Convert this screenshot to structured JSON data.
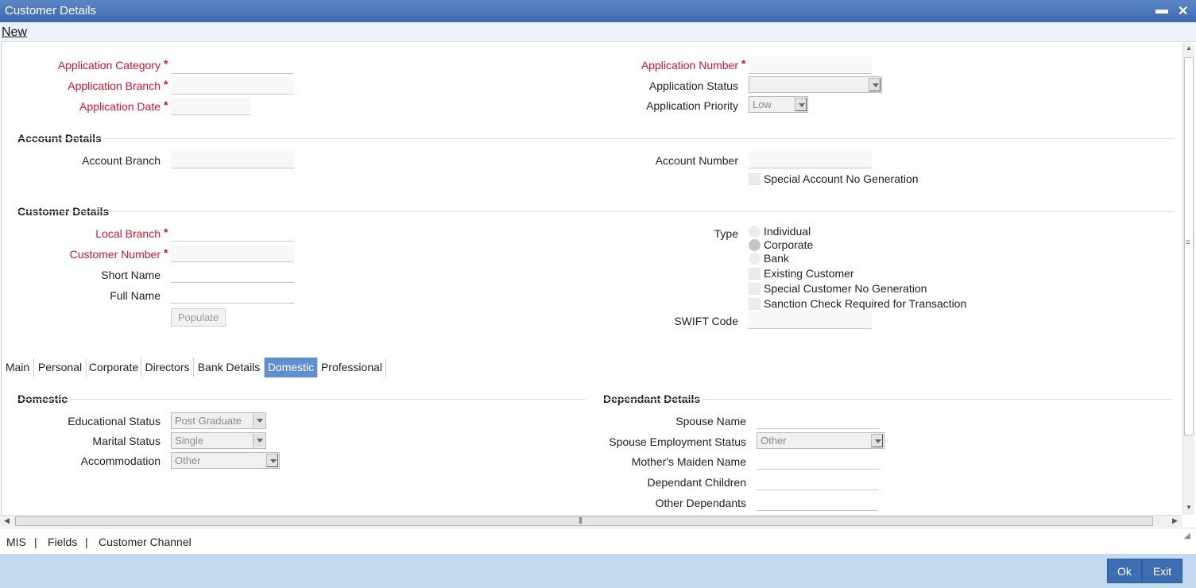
{
  "window": {
    "title": "Customer Details",
    "minimize_icon": "minimize-icon",
    "close_icon": "close-icon"
  },
  "menu": {
    "new_label": "New"
  },
  "header": {
    "app_category_label": "Application Category",
    "app_branch_label": "Application Branch",
    "app_date_label": "Application Date",
    "app_number_label": "Application Number",
    "app_status_label": "Application Status",
    "app_status_value": "",
    "app_priority_label": "Application Priority",
    "app_priority_value": "Low",
    "required_mark": "*"
  },
  "account": {
    "section_title": "Account Details",
    "branch_label": "Account Branch",
    "number_label": "Account Number",
    "special_no_label": "Special Account No Generation"
  },
  "customer": {
    "section_title": "Customer Details",
    "local_branch_label": "Local Branch",
    "customer_number_label": "Customer Number",
    "short_name_label": "Short Name",
    "full_name_label": "Full Name",
    "populate_label": "Populate",
    "type_label": "Type",
    "type_options": [
      "Individual",
      "Corporate",
      "Bank"
    ],
    "type_selected": "Corporate",
    "existing_customer_label": "Existing Customer",
    "special_customer_no_label": "Special Customer No Generation",
    "sanction_check_label": "Sanction Check Required for Transaction",
    "swift_code_label": "SWIFT Code"
  },
  "tabs": [
    "Main",
    "Personal",
    "Corporate",
    "Directors",
    "Bank Details",
    "Domestic",
    "Professional"
  ],
  "active_tab": "Domestic",
  "domestic": {
    "section_title": "Domestic",
    "educational_status_label": "Educational Status",
    "educational_status_value": "Post Graduate",
    "marital_status_label": "Marital Status",
    "marital_status_value": "Single",
    "accommodation_label": "Accommodation",
    "accommodation_value": "Other"
  },
  "dependant": {
    "section_title": "Dependant Details",
    "spouse_name_label": "Spouse Name",
    "spouse_employment_label": "Spouse Employment Status",
    "spouse_employment_value": "Other",
    "mothers_maiden_label": "Mother's Maiden Name",
    "dependant_children_label": "Dependant Children",
    "other_dependants_label": "Other Dependants"
  },
  "bottom_links": {
    "mis": "MIS",
    "fields": "Fields",
    "customer_channel": "Customer Channel",
    "separator": "|"
  },
  "footer": {
    "ok_label": "Ok",
    "exit_label": "Exit"
  }
}
